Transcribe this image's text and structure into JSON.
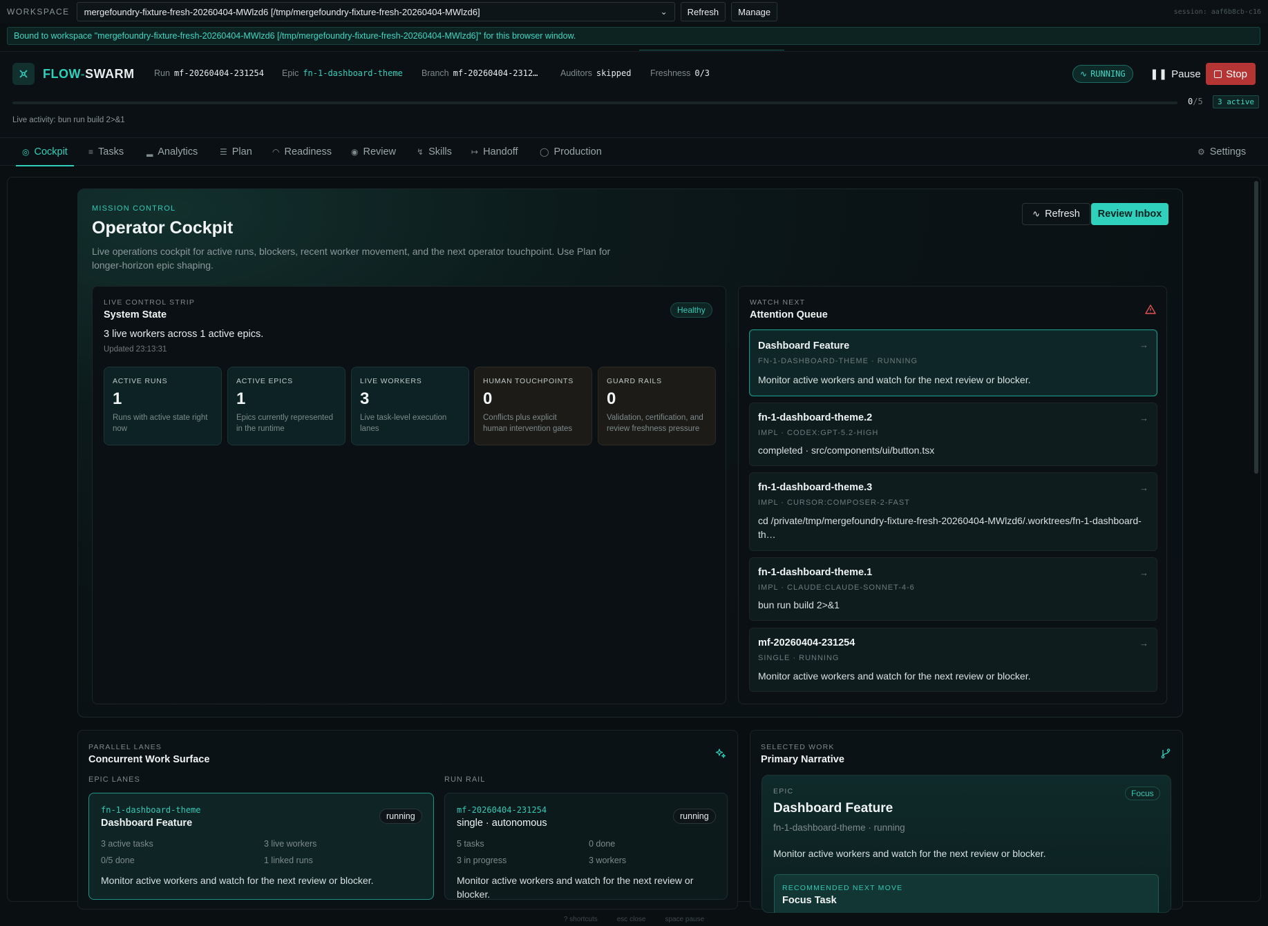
{
  "workspace": {
    "label": "WORKSPACE",
    "selected": "mergefoundry-fixture-fresh-20260404-MWlzd6 [/tmp/mergefoundry-fixture-fresh-20260404-MWlzd6]",
    "refresh_label": "Refresh",
    "manage_label": "Manage",
    "session": "session: aaf6b8cb-c16",
    "bound_message": "Bound to workspace \"mergefoundry-fixture-fresh-20260404-MWlzd6 [/tmp/mergefoundry-fixture-fresh-20260404-MWlzd6]\" for this browser window."
  },
  "header": {
    "brand_a": "FLOW",
    "brand_dash": "-",
    "brand_b": "SWARM",
    "run_label": "Run",
    "run_value": "mf-20260404-231254",
    "epic_label": "Epic",
    "epic_value": "fn-1-dashboard-theme",
    "branch_label": "Branch",
    "branch_value": "mf-20260404-2312…",
    "auditors_label": "Auditors",
    "auditors_value": "skipped",
    "freshness_label": "Freshness",
    "freshness_value": "0/3",
    "status": "RUNNING",
    "pause_label": "Pause",
    "stop_label": "Stop",
    "progress_done": "0",
    "progress_total": "/5",
    "progress_fraction": 0,
    "active_badge": "3 active",
    "live_activity": "Live activity: bun run build 2>&1",
    "accent_color": "#2fd1bc",
    "stop_color": "#b53434"
  },
  "tabs": [
    {
      "label": "Cockpit",
      "icon": "target-icon"
    },
    {
      "label": "Tasks",
      "icon": "list-icon"
    },
    {
      "label": "Analytics",
      "icon": "bar-chart-icon"
    },
    {
      "label": "Plan",
      "icon": "lines-icon"
    },
    {
      "label": "Readiness",
      "icon": "gauge-icon"
    },
    {
      "label": "Review",
      "icon": "eye-icon"
    },
    {
      "label": "Skills",
      "icon": "bolt-icon"
    },
    {
      "label": "Handoff",
      "icon": "handoff-icon"
    },
    {
      "label": "Production",
      "icon": "shield-icon"
    },
    {
      "label": "Settings",
      "icon": "gear-icon"
    }
  ],
  "cockpit": {
    "eyebrow": "MISSION CONTROL",
    "title": "Operator Cockpit",
    "description": "Live operations cockpit for active runs, blockers, recent worker movement, and the next operator touchpoint. Use Plan for longer-horizon epic shaping.",
    "refresh_label": "Refresh",
    "review_inbox_label": "Review Inbox"
  },
  "system_state": {
    "eyebrow": "LIVE CONTROL STRIP",
    "title": "System State",
    "health": "Healthy",
    "summary": "3 live workers across 1 active epics.",
    "updated": "Updated 23:13:31",
    "stats": [
      {
        "label": "ACTIVE RUNS",
        "value": "1",
        "desc": "Runs with active state right now"
      },
      {
        "label": "ACTIVE EPICS",
        "value": "1",
        "desc": "Epics currently represented in the runtime"
      },
      {
        "label": "LIVE WORKERS",
        "value": "3",
        "desc": "Live task-level execution lanes"
      },
      {
        "label": "HUMAN TOUCHPOINTS",
        "value": "0",
        "desc": "Conflicts plus explicit human intervention gates"
      },
      {
        "label": "GUARD RAILS",
        "value": "0",
        "desc": "Validation, certification, and review freshness pressure"
      }
    ]
  },
  "attention": {
    "eyebrow": "WATCH NEXT",
    "title": "Attention Queue",
    "items": [
      {
        "title": "Dashboard Feature",
        "sub": "FN-1-DASHBOARD-THEME · RUNNING",
        "desc": "Monitor active workers and watch for the next review or blocker."
      },
      {
        "title": "fn-1-dashboard-theme.2",
        "sub": "IMPL · CODEX:GPT-5.2-HIGH",
        "desc": "completed · src/components/ui/button.tsx"
      },
      {
        "title": "fn-1-dashboard-theme.3",
        "sub": "IMPL · CURSOR:COMPOSER-2-FAST",
        "desc": "cd /private/tmp/mergefoundry-fixture-fresh-20260404-MWlzd6/.worktrees/fn-1-dashboard-th…"
      },
      {
        "title": "fn-1-dashboard-theme.1",
        "sub": "IMPL · CLAUDE:CLAUDE-SONNET-4-6",
        "desc": "bun run build 2>&1"
      },
      {
        "title": "mf-20260404-231254",
        "sub": "SINGLE · RUNNING",
        "desc": "Monitor active workers and watch for the next review or blocker."
      }
    ]
  },
  "parallel": {
    "eyebrow": "PARALLEL LANES",
    "title": "Concurrent Work Surface",
    "epic_lanes_label": "EPIC LANES",
    "run_rail_label": "RUN RAIL",
    "epic_lane": {
      "id": "fn-1-dashboard-theme",
      "name": "Dashboard Feature",
      "status": "running",
      "m1": "3 active tasks",
      "m2": "3 live workers",
      "m3": "0/5 done",
      "m4": "1 linked runs",
      "desc": "Monitor active workers and watch for the next review or blocker."
    },
    "run_lane": {
      "id": "mf-20260404-231254",
      "name": "single · autonomous",
      "status": "running",
      "m1": "5 tasks",
      "m2": "0 done",
      "m3": "3 in progress",
      "m4": "3 workers",
      "desc": "Monitor active workers and watch for the next review or blocker."
    }
  },
  "selected_work": {
    "eyebrow": "SELECTED WORK",
    "title": "Primary Narrative",
    "kind": "EPIC",
    "badge": "Focus",
    "name": "Dashboard Feature",
    "sub": "fn-1-dashboard-theme · running",
    "desc": "Monitor active workers and watch for the next review or blocker.",
    "rec_label": "RECOMMENDED NEXT MOVE",
    "rec_title": "Focus Task"
  },
  "footer": [
    "? shortcuts",
    "esc close",
    "space pause"
  ]
}
